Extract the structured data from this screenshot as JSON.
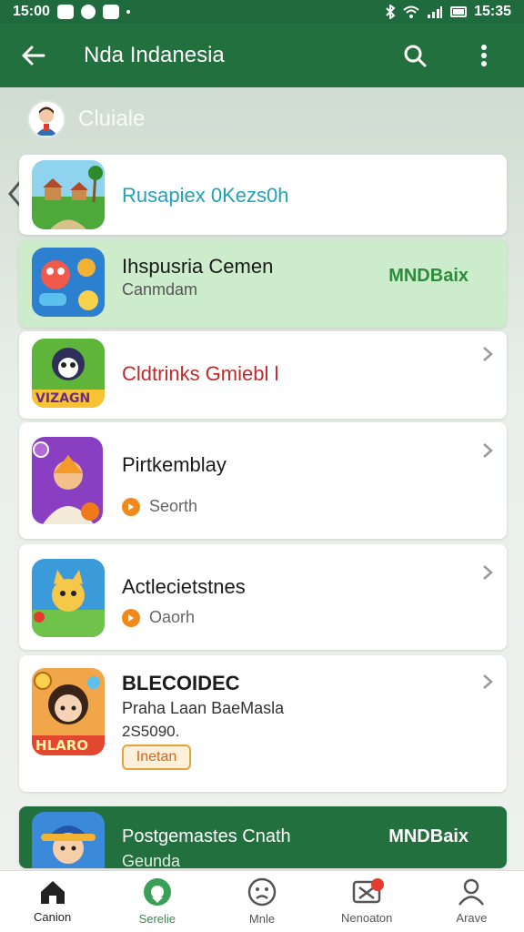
{
  "status": {
    "left_time": "15:00",
    "right_time": "15:35"
  },
  "appbar": {
    "title": "Nda Indanesia",
    "back_icon": "arrow-left-icon",
    "search_icon": "search-icon",
    "menu_icon": "more-vert-icon"
  },
  "user": {
    "name": "Cluiale"
  },
  "cards": [
    {
      "title": "Rusapiex 0Kezs0h",
      "title_color": "#1fa3b8"
    },
    {
      "title": "Ihspusria Cemen",
      "subtitle": "Canmdam",
      "right": "MNDBaix"
    },
    {
      "title": "Cldtrinks Gmiebl l",
      "title_color": "#c22a2a",
      "thumb_text": "VIZAGN"
    },
    {
      "title": "Pirtkemblay",
      "meta": "Seorth"
    },
    {
      "title": "Actlecietstnes",
      "meta": "Oaorh"
    },
    {
      "title": "BLECOIDEC",
      "subtitle": "Praha Laan BaeMasla",
      "extra": "2S5090.",
      "button": "Inetan",
      "thumb_text": "HLARO"
    },
    {
      "title": "Postgemastes Cnath",
      "subtitle": "Geunda",
      "right": "MNDBaix"
    }
  ],
  "nav": [
    {
      "label": "Canion",
      "icon": "home-icon",
      "active": true
    },
    {
      "label": "Serelie",
      "icon": "circle-icon"
    },
    {
      "label": "Mnle",
      "icon": "face-icon"
    },
    {
      "label": "Nenoaton",
      "icon": "notification-icon",
      "badge": true
    },
    {
      "label": "Arave",
      "icon": "person-icon"
    }
  ],
  "colors": {
    "primary": "#23703f",
    "accent": "#2e8a3c"
  }
}
